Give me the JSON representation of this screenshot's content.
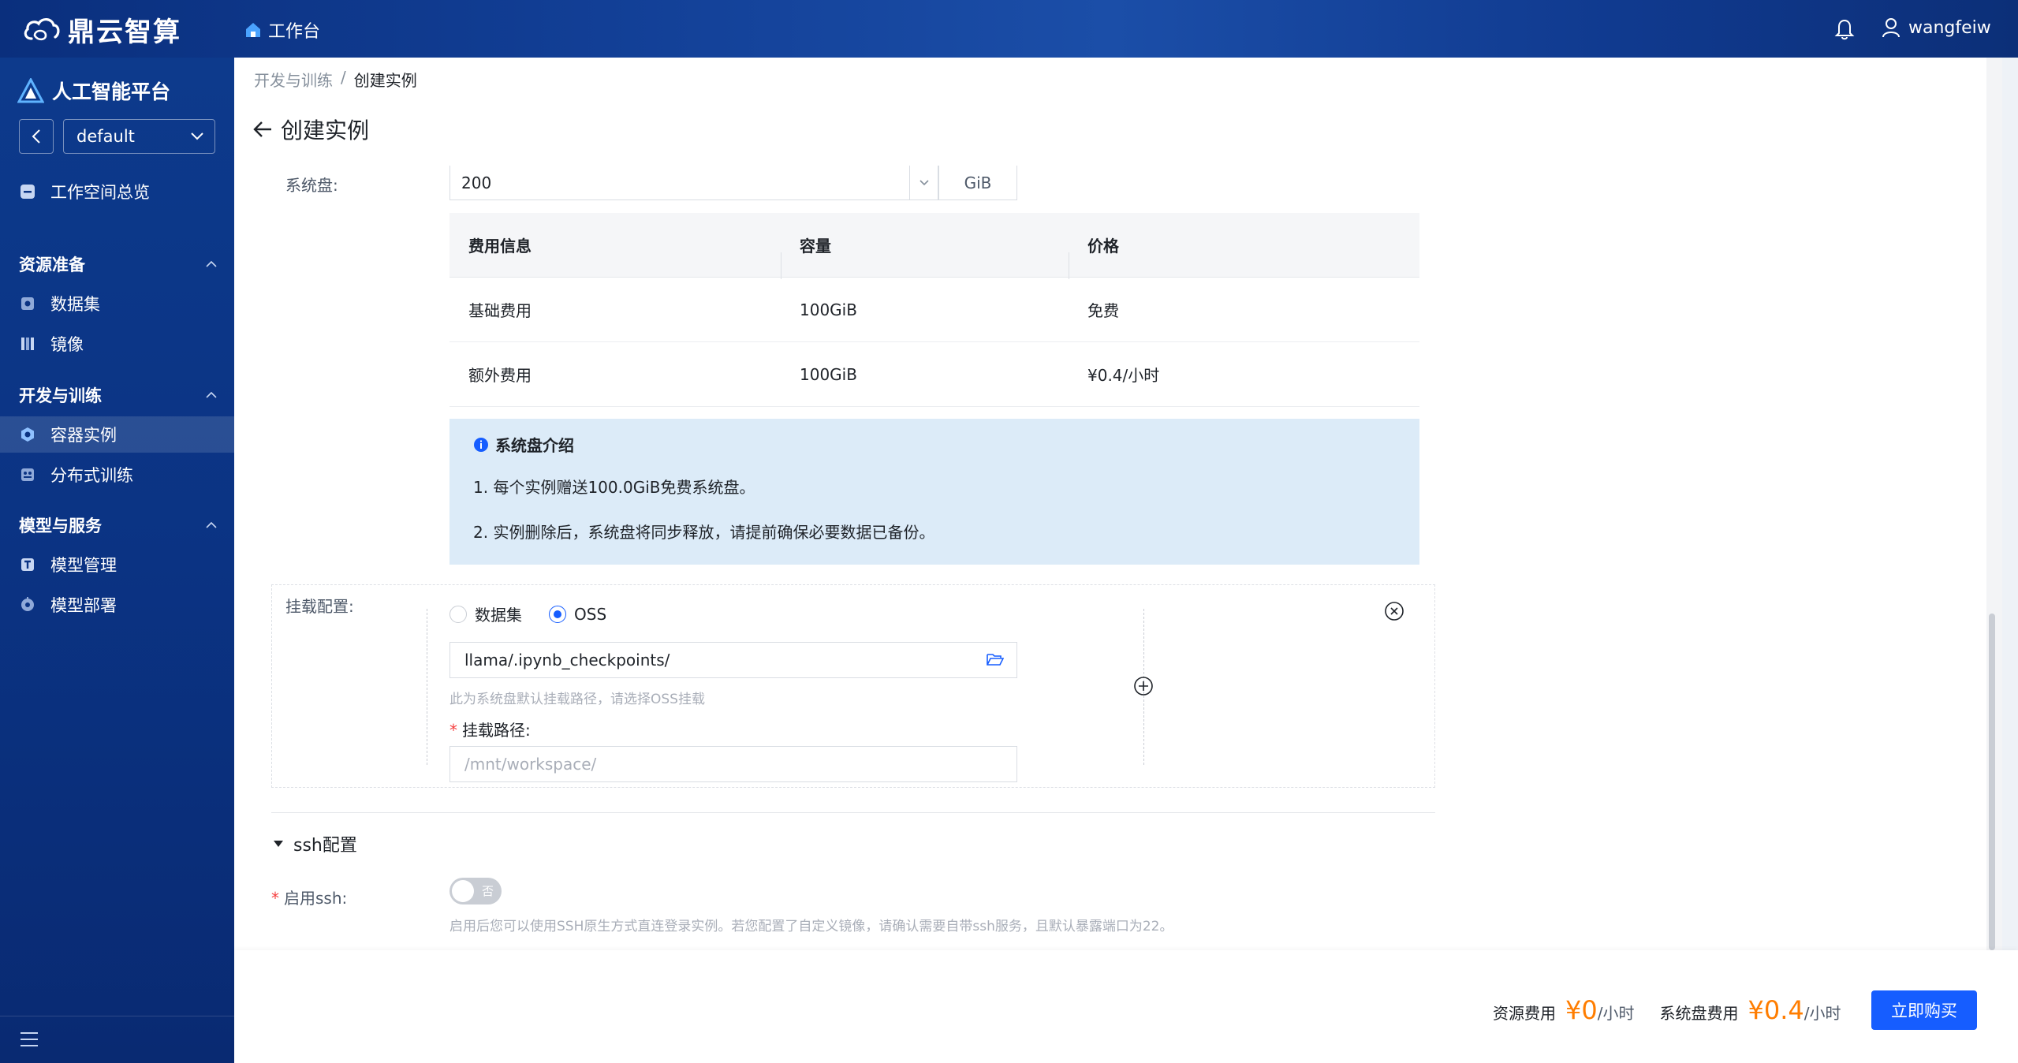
{
  "topbar": {
    "brand": "鼎云智算",
    "workbench": "工作台",
    "username": "wangfeiw"
  },
  "sidebar": {
    "platform": "人工智能平台",
    "workspace": "default",
    "overview": "工作空间总览",
    "groups": [
      {
        "title": "资源准备",
        "items": [
          "数据集",
          "镜像"
        ]
      },
      {
        "title": "开发与训练",
        "items": [
          "容器实例",
          "分布式训练"
        ]
      },
      {
        "title": "模型与服务",
        "items": [
          "模型管理",
          "模型部署"
        ]
      }
    ],
    "active_item": "容器实例"
  },
  "breadcrumb": {
    "parent": "开发与训练",
    "separator": "/",
    "current": "创建实例"
  },
  "page": {
    "title": "创建实例"
  },
  "system_disk": {
    "label": "系统盘:",
    "value": "200",
    "unit": "GiB",
    "table": {
      "headers": [
        "费用信息",
        "容量",
        "价格"
      ],
      "rows": [
        [
          "基础费用",
          "100GiB",
          "免费"
        ],
        [
          "额外费用",
          "100GiB",
          "¥0.4/小时"
        ]
      ]
    },
    "info": {
      "title": "系统盘介绍",
      "lines": [
        "1. 每个实例赠送100.0GiB免费系统盘。",
        "2. 实例删除后，系统盘将同步释放，请提前确保必要数据已备份。"
      ]
    }
  },
  "mount": {
    "label": "挂载配置:",
    "options": [
      "数据集",
      "OSS"
    ],
    "selected": "OSS",
    "oss_path": "llama/.ipynb_checkpoints/",
    "oss_hint": "此为系统盘默认挂载路径，请选择OSS挂载",
    "mount_path_label": "挂载路径:",
    "mount_path_placeholder": "/mnt/workspace/"
  },
  "ssh": {
    "section_title": "ssh配置",
    "enable_label": "启用ssh:",
    "toggle_text": "否",
    "hint": "启用后您可以使用SSH原生方式直连登录实例。若您配置了自定义镜像，请确认需要自带ssh服务，且默认暴露端口为22。"
  },
  "footer": {
    "resource_fee_label": "资源费用",
    "resource_fee": "¥0",
    "disk_fee_label": "系统盘费用",
    "disk_fee": "¥0.4",
    "per_hour": "/小时",
    "buy_button": "立即购买"
  },
  "colors": {
    "primary": "#165dff",
    "price": "#ff7d00",
    "sidebar": "#0b3383",
    "info_bg": "#dcebf8"
  }
}
